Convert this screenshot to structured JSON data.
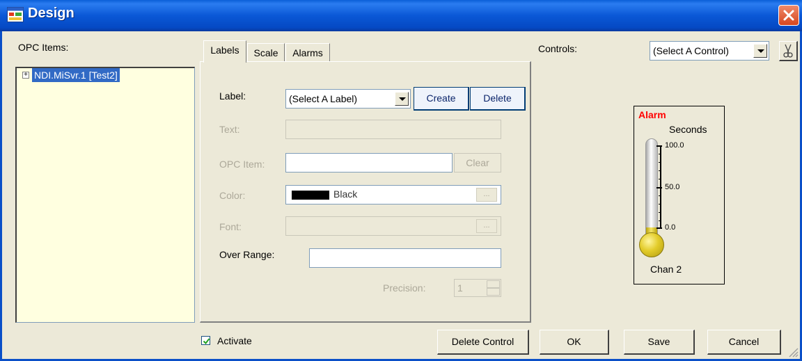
{
  "window": {
    "title": "Design",
    "icon": "design-app-icon",
    "close": "close-icon"
  },
  "opc": {
    "label": "OPC Items:",
    "tree": [
      {
        "label": "NDI.MiSvr.1 [Test2]",
        "expanded": false,
        "selected": true
      }
    ]
  },
  "tabs": [
    {
      "label": "Labels",
      "active": true
    },
    {
      "label": "Scale",
      "active": false
    },
    {
      "label": "Alarms",
      "active": false
    }
  ],
  "labels_form": {
    "label_label": "Label:",
    "label_value": "(Select A Label)",
    "create": "Create",
    "delete": "Delete",
    "text_label": "Text:",
    "opc_item_label": "OPC Item:",
    "clear": "Clear",
    "color_label": "Color:",
    "color_name": "Black",
    "color_swatch": "#000000",
    "font_label": "Font:",
    "ellipsis": "...",
    "over_range_label": "Over Range:",
    "precision_label": "Precision:",
    "precision_value": "1"
  },
  "controls": {
    "label": "Controls:",
    "selected": "(Select A Control)",
    "cut_icon": "scissors-icon"
  },
  "gauge": {
    "alarm": "Alarm",
    "alarm_color": "#ff0000",
    "unit": "Seconds",
    "ticks": [
      "100.0",
      "50.0",
      "0.0"
    ],
    "level": 0.0,
    "name": "Chan 2",
    "bulb_color": "#e3cc2a"
  },
  "footer": {
    "activate": "Activate",
    "activate_checked": true,
    "delete_control": "Delete Control",
    "ok": "OK",
    "save": "Save",
    "cancel": "Cancel"
  }
}
